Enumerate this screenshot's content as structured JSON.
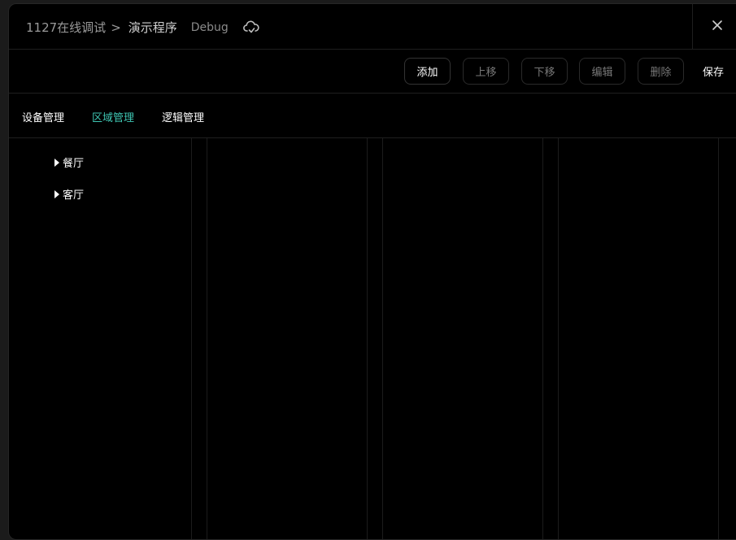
{
  "header": {
    "project": "1127在线调试",
    "separator": ">",
    "program": "演示程序",
    "mode": "Debug"
  },
  "toolbar": {
    "add": "添加",
    "move_up": "上移",
    "move_down": "下移",
    "edit": "编辑",
    "delete": "删除",
    "save": "保存"
  },
  "tabs": [
    {
      "label": "设备管理"
    },
    {
      "label": "区域管理"
    },
    {
      "label": "逻辑管理"
    }
  ],
  "tree": [
    {
      "label": "餐厅"
    },
    {
      "label": "客厅"
    }
  ],
  "colors": {
    "accent": "#3ec5b2",
    "background": "#000000"
  },
  "icons": {
    "cloud": "cloud-check-icon",
    "close": "close-icon",
    "caret": "caret-right-icon"
  }
}
